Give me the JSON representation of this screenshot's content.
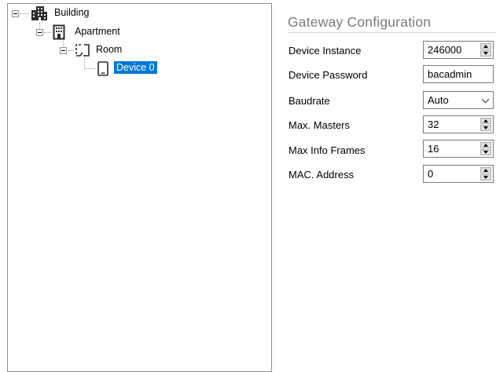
{
  "tree": {
    "building": {
      "label": "Building",
      "icon": "building-icon"
    },
    "apartment": {
      "label": "Apartment",
      "icon": "apartment-icon"
    },
    "room": {
      "label": "Room",
      "icon": "room-icon"
    },
    "device": {
      "label": "Device 0",
      "icon": "tablet-device-icon",
      "selected": true
    }
  },
  "config": {
    "title": "Gateway Configuration",
    "fields": {
      "device_instance": {
        "label": "Device Instance",
        "value": "246000",
        "control": "spinner"
      },
      "device_password": {
        "label": "Device Password",
        "value": "bacadmin",
        "control": "text"
      },
      "baudrate": {
        "label": "Baudrate",
        "value": "Auto",
        "control": "dropdown"
      },
      "max_masters": {
        "label": "Max. Masters",
        "value": "32",
        "control": "spinner"
      },
      "max_info_frames": {
        "label": "Max Info Frames",
        "value": "16",
        "control": "spinner"
      },
      "mac_address": {
        "label": "MAC. Address",
        "value": "0",
        "control": "spinner"
      }
    }
  },
  "colors": {
    "selection": "#0078d7",
    "title_gray": "#7a7a7a",
    "border": "#7a7a7a"
  }
}
